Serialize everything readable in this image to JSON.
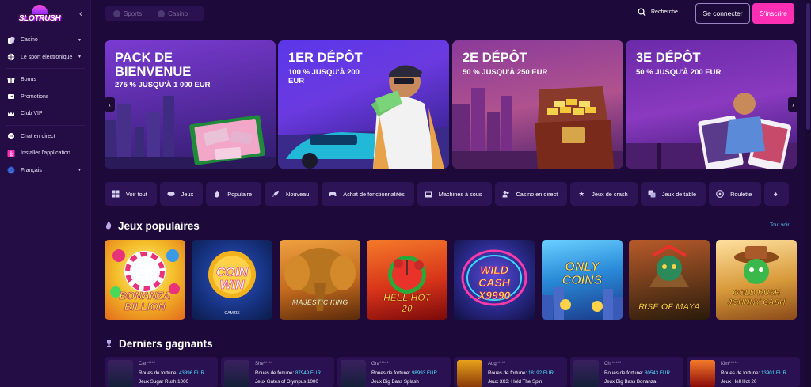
{
  "brand": {
    "logo_text": "SLOTRUSH"
  },
  "sidebar": {
    "items": [
      {
        "label": "Casino",
        "icon": "cards-icon",
        "caret": true
      },
      {
        "label": "Le sport électronique",
        "icon": "ball-icon",
        "caret": true
      },
      {
        "label": "Bonus",
        "icon": "gift-icon",
        "caret": false
      },
      {
        "label": "Promotions",
        "icon": "tag-icon",
        "caret": false
      },
      {
        "label": "Club VIP",
        "icon": "crown-icon",
        "caret": false
      },
      {
        "label": "Chat en direct",
        "icon": "chat-icon",
        "caret": false
      },
      {
        "label": "Installer l'application",
        "icon": "download-icon",
        "caret": false
      },
      {
        "label": "Français",
        "icon": "flag-icon",
        "caret": true
      }
    ]
  },
  "topbar": {
    "tabs": [
      {
        "label": "Sports"
      },
      {
        "label": "Casino"
      }
    ],
    "search_label": "Recherche",
    "login_label": "Se connecter",
    "signup_label": "S'inscrire"
  },
  "banners": [
    {
      "title": "PACK DE BIENVENUE",
      "subtitle": "275 % JUSQU'À 1 000 EUR"
    },
    {
      "title": "1ER DÉPÔT",
      "subtitle": "100 % JUSQU'À 200 EUR"
    },
    {
      "title": "2E DÉPÔT",
      "subtitle": "50 % JUSQU'À 250 EUR"
    },
    {
      "title": "3E DÉPÔT",
      "subtitle": "50 % JUSQU'À 200 EUR"
    }
  ],
  "categories": [
    {
      "label": "Voir tout",
      "icon": "grid-icon"
    },
    {
      "label": "Jeux",
      "icon": "gamepad-icon"
    },
    {
      "label": "Populaire",
      "icon": "flame-icon"
    },
    {
      "label": "Nouveau",
      "icon": "rocket-icon"
    },
    {
      "label": "Achat de fonctionnalités",
      "icon": "controller-icon"
    },
    {
      "label": "Machines à sous",
      "icon": "slot-machine-icon"
    },
    {
      "label": "Casino en direct",
      "icon": "live-dealer-icon"
    },
    {
      "label": "Jeux de crash",
      "icon": "star-icon"
    },
    {
      "label": "Jeux de table",
      "icon": "dice-icon"
    },
    {
      "label": "Roulette",
      "icon": "roulette-icon"
    },
    {
      "label": "",
      "icon": "spade-icon"
    }
  ],
  "popular": {
    "title": "Jeux populaires",
    "see_all": "Tout voir",
    "games": [
      {
        "name": "BONANZA BILLION",
        "provider": "",
        "bg": "#f2b21e"
      },
      {
        "name": "COIN WIN",
        "provider": "GAMZIX",
        "bg": "#1a3a9a"
      },
      {
        "name": "MAJESTIC KING",
        "provider": "",
        "bg": "#c26a1e"
      },
      {
        "name": "HELL HOT 20",
        "provider": "",
        "bg": "#d8341a"
      },
      {
        "name": "WILD CASH X9990",
        "provider": "",
        "bg": "#2a2a8a"
      },
      {
        "name": "ONLY COINS",
        "provider": "",
        "bg": "#2a8ad8"
      },
      {
        "name": "RISE OF MAYA",
        "provider": "",
        "bg": "#6a3a1a"
      },
      {
        "name": "GOLD RUSH JOHNNY CASH",
        "provider": "",
        "bg": "#d89a3a"
      }
    ]
  },
  "winners": {
    "title": "Derniers gagnants",
    "items": [
      {
        "user": "Car*****",
        "prefix": "Roues de fortune:",
        "amount": "43396 EUR",
        "game": "Jeux Sugar Rush 1000"
      },
      {
        "user": "She*****",
        "prefix": "Roues de fortune:",
        "amount": "87949 EUR",
        "game": "Jeux Gates of Olympus 1000"
      },
      {
        "user": "Gra*****",
        "prefix": "Roues de fortune:",
        "amount": "98993 EUR",
        "game": "Jeux Big Bass Splash"
      },
      {
        "user": "Aug*****",
        "prefix": "Roues de fortune:",
        "amount": "18192 EUR",
        "game": "Jeux 3X3: Hold The Spin"
      },
      {
        "user": "Chr*****",
        "prefix": "Roues de fortune:",
        "amount": "80543 EUR",
        "game": "Jeux Big Bass Bonanza"
      },
      {
        "user": "Kim*****",
        "prefix": "Roues de fortune:",
        "amount": "13901 EUR",
        "game": "Jeux Hell Hot 20"
      }
    ]
  },
  "colors": {
    "background": "#1e0a3a",
    "sidebar": "#240c44",
    "accent": "#ff2fb3",
    "amount": "#4fe3ff",
    "link": "#5ed0ff"
  }
}
